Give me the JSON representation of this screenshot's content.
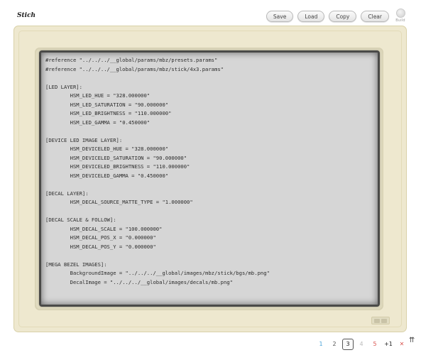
{
  "app": {
    "title": "Stich"
  },
  "toolbar": {
    "buttons": [
      {
        "label": "Save"
      },
      {
        "label": "Load"
      },
      {
        "label": "Copy"
      },
      {
        "label": "Clear"
      }
    ],
    "build_label": "Build"
  },
  "editor": {
    "lines": [
      "#reference \"../../../__global/params/mbz/presets.params\"",
      "#reference \"../../../__global/params/mbz/stick/4x3.params\"",
      "",
      "[LED LAYER]:",
      "\tHSM_LED_HUE = \"328.000000\"",
      "\tHSM_LED_SATURATION = \"90.000000\"",
      "\tHSM_LED_BRIGHTNESS = \"110.000000\"",
      "\tHSM_LED_GAMMA = \"0.450000\"",
      "",
      "[DEVICE LED IMAGE LAYER]:",
      "\tHSM_DEVICELED_HUE = \"328.000000\"",
      "\tHSM_DEVICELED_SATURATION = \"90.000000\"",
      "\tHSM_DEVICELED_BRIGHTNESS = \"110.000000\"",
      "\tHSM_DEVICELED_GAMMA = \"0.450000\"",
      "",
      "[DECAL LAYER]:",
      "\tHSM_DECAL_SOURCE_MATTE_TYPE = \"1.000000\"",
      "",
      "[DECAL SCALE & FOLLOW]:",
      "\tHSM_DECAL_SCALE = \"100.000000\"",
      "\tHSM_DECAL_POS_X = \"0.000000\"",
      "\tHSM_DECAL_POS_Y = \"0.000000\"",
      "",
      "[MEGA BEZEL IMAGES]:",
      "\tBackgroundImage = \"../../../__global/images/mbz/stick/bgs/mb.png\"",
      "\tDecalImage = \"../../../__global/images/decals/mb.png\""
    ]
  },
  "pager": {
    "pages": [
      "1",
      "2",
      "3",
      "4",
      "5"
    ],
    "current": "3",
    "plus_label": "+1",
    "close_icon": "✕",
    "scroll_up_icon": "⇈"
  }
}
